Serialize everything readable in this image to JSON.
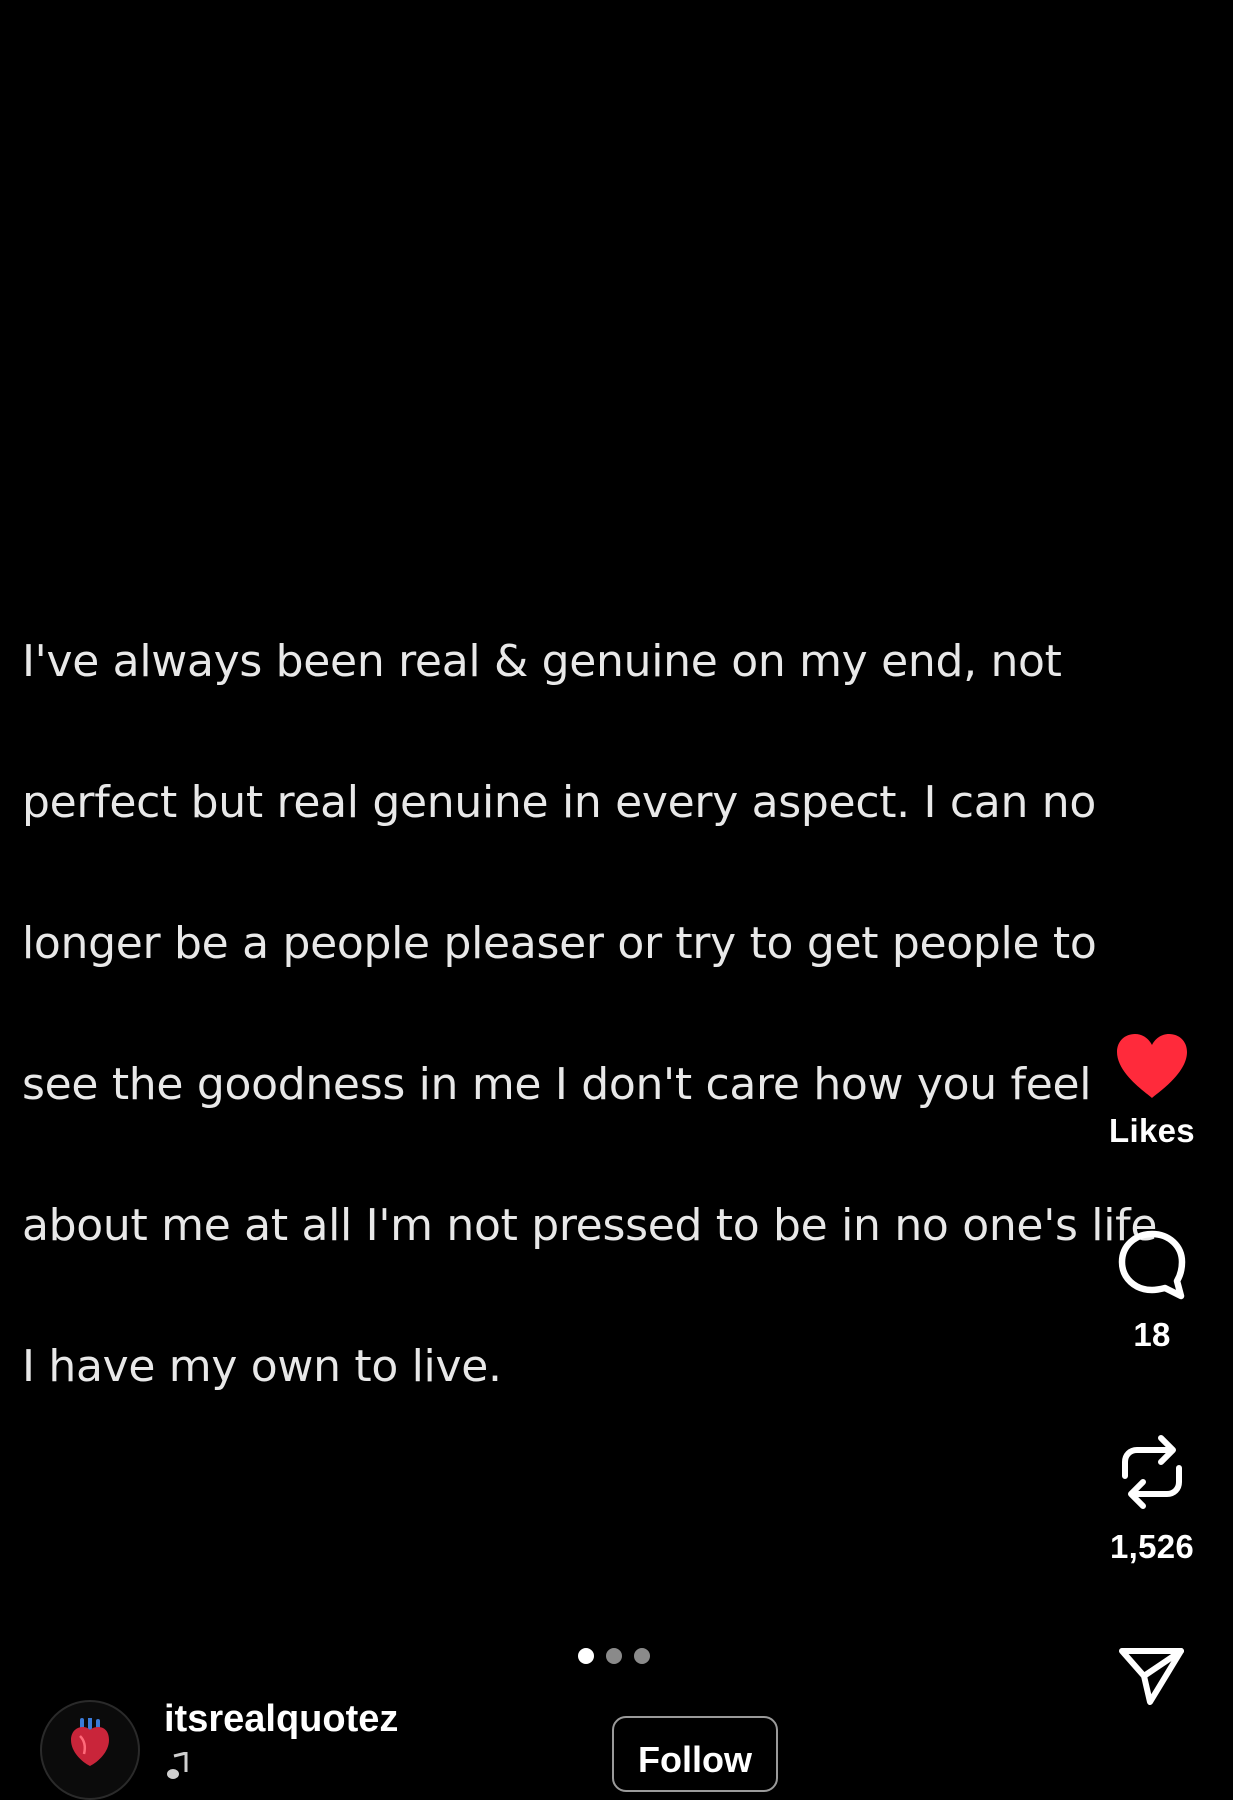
{
  "post": {
    "caption_lines": [
      "I've always been real & genuine on my end, not",
      "perfect but real genuine in every aspect. I can no",
      "longer be a people pleaser or try to get people to",
      "see the goodness in me I don't care how you feel",
      "about me at all I'm not pressed to be in no one's life",
      "I have my own to live."
    ]
  },
  "actions": {
    "like": {
      "icon": "heart-icon",
      "label": "Likes",
      "color": "#ff2a3b"
    },
    "comment": {
      "icon": "comment-bubble-icon",
      "label": "18"
    },
    "repost": {
      "icon": "repost-arrows-icon",
      "label": "1,526"
    },
    "share": {
      "icon": "send-paper-plane-icon"
    }
  },
  "pager": {
    "count": 3,
    "active_index": 0
  },
  "author": {
    "username": "itsrealquotez",
    "avatar_icon": "anatomical-heart-icon",
    "music_icon": "music-note-icon",
    "follow_label": "Follow"
  },
  "colors": {
    "background": "#000000",
    "text": "#e8e8e8",
    "like_red": "#ff2a3b"
  }
}
